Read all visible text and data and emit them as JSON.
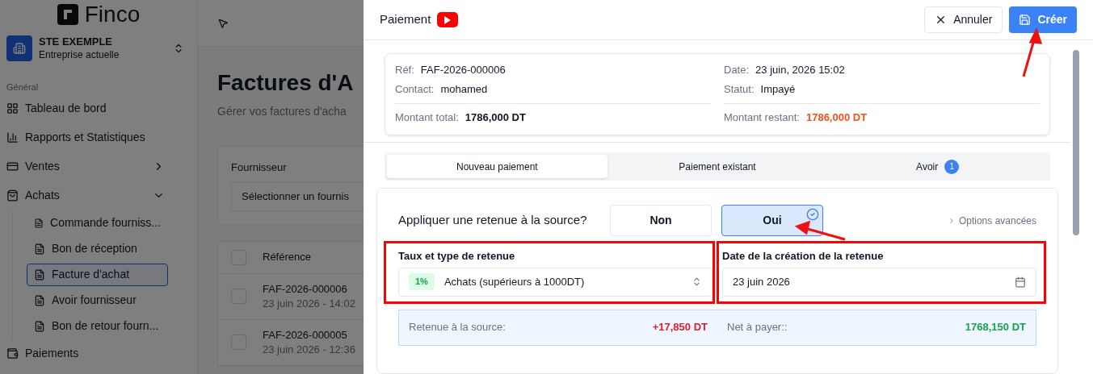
{
  "sidebar": {
    "logo": "Finco",
    "company": {
      "name": "STE EXEMPLE",
      "subtitle": "Entreprise actuelle"
    },
    "section": "Général",
    "items": [
      {
        "label": "Tableau de bord"
      },
      {
        "label": "Rapports et Statistiques"
      },
      {
        "label": "Ventes",
        "expanded": false
      },
      {
        "label": "Achats",
        "expanded": true,
        "children": [
          {
            "label": "Commande fourniss...",
            "selected": false
          },
          {
            "label": "Bon de réception",
            "selected": false
          },
          {
            "label": "Facture d'achat",
            "selected": true
          },
          {
            "label": "Avoir fournisseur",
            "selected": false
          },
          {
            "label": "Bon de retour fourn...",
            "selected": false
          }
        ]
      },
      {
        "label": "Paiements"
      }
    ]
  },
  "main": {
    "title": "Factures d'A",
    "subtitle": "Gérer vos factures d'acha",
    "filter_label": "Fournisseur",
    "filter_placeholder": "Sélectionner un fournis",
    "column_1": "Référence",
    "all_checked": false,
    "rows": [
      {
        "ref": "FAF-2026-000006",
        "date": "23 juin 2026 - 14:02",
        "checked": false
      },
      {
        "ref": "FAF-2026-000005",
        "date": "23 juin 2026 - 12:36",
        "checked": false
      }
    ]
  },
  "dialog": {
    "title": "Paiement",
    "cancel": "Annuler",
    "create": "Créer",
    "info": [
      {
        "label": "Réf:",
        "value": "FAF-2026-000006",
        "kind": "plain"
      },
      {
        "label": "Date:",
        "value": "23 juin, 2026 15:02",
        "kind": "plain"
      },
      {
        "label": "Contact:",
        "value": "mohamed",
        "kind": "plain"
      },
      {
        "label": "Statut:",
        "value": "Impayé",
        "kind": "plain"
      },
      {
        "label": "Montant total:",
        "value": "1786,000 DT",
        "kind": "total"
      },
      {
        "label": "Montant restant:",
        "value": "1786,000 DT",
        "kind": "due"
      }
    ],
    "tabs": [
      {
        "label": "Nouveau paiement",
        "selected": true
      },
      {
        "label": "Paiement existant",
        "selected": false
      },
      {
        "label": "Avoir",
        "selected": false,
        "badge": "1"
      }
    ],
    "question": "Appliquer une retenue à la source?",
    "choices": [
      {
        "label": "Non",
        "selected": false
      },
      {
        "label": "Oui",
        "selected": true
      }
    ],
    "advanced": "Options avancées",
    "rate_label": "Taux et type de retenue",
    "rate_badge": "1%",
    "rate_value": "Achats (supérieurs à 1000DT)",
    "date_label": "Date de la création de la retenue",
    "date_value": "23 juin 2026",
    "summary": [
      {
        "label": "Retenue à la source:",
        "value": "+17,850 DT",
        "color": "#e11d2e"
      },
      {
        "label": "Net à payer::",
        "value": "1768,150 DT",
        "color": "#16a34a"
      }
    ]
  }
}
